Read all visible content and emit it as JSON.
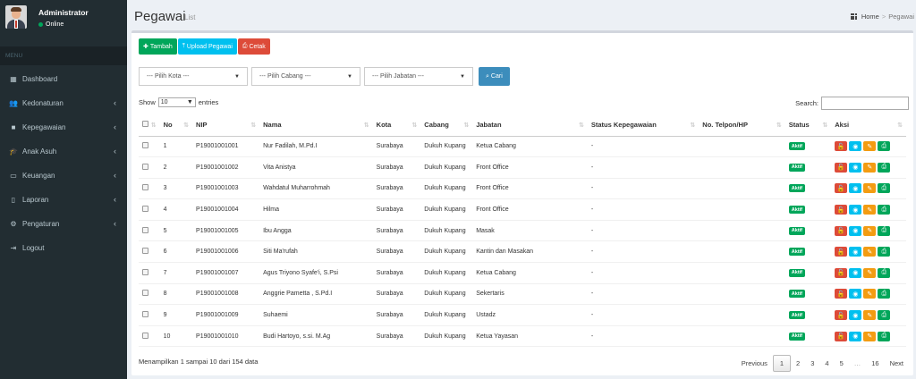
{
  "user": {
    "name": "Administrator",
    "status": "Online"
  },
  "menu_header": "MENU",
  "menu": [
    {
      "label": "Dashboard",
      "icon": "dashboard-icon",
      "glyph": "▦",
      "expandable": false
    },
    {
      "label": "Kedonaturan",
      "icon": "users-icon",
      "glyph": "👥",
      "expandable": true
    },
    {
      "label": "Kepegawaian",
      "icon": "briefcase-icon",
      "glyph": "■",
      "expandable": true
    },
    {
      "label": "Anak Asuh",
      "icon": "graduation-cap-icon",
      "glyph": "🎓",
      "expandable": true
    },
    {
      "label": "Keuangan",
      "icon": "money-icon",
      "glyph": "▭",
      "expandable": true
    },
    {
      "label": "Laporan",
      "icon": "file-icon",
      "glyph": "▯",
      "expandable": true
    },
    {
      "label": "Pengaturan",
      "icon": "gear-icon",
      "glyph": "⚙",
      "expandable": true
    },
    {
      "label": "Logout",
      "icon": "sign-out-icon",
      "glyph": "⇥",
      "expandable": false
    }
  ],
  "page": {
    "title": "Pegawai",
    "subtitle": "List"
  },
  "breadcrumb": {
    "home": "Home",
    "current": "Pegawai"
  },
  "toolbar": {
    "add": "Tambah",
    "upload": "Upload Pegawai",
    "print": "Cetak"
  },
  "filters": {
    "kota": "--- Pilih Kota ---",
    "cabang": "--- Pilih Cabang ---",
    "jabatan": "--- Pilih Jabatan ---",
    "search_button": "Cari"
  },
  "length": {
    "show": "Show",
    "value": "10",
    "entries": "entries"
  },
  "search_label": "Search:",
  "columns": [
    "No",
    "NIP",
    "Nama",
    "Kota",
    "Cabang",
    "Jabatan",
    "Status Kepegawaian",
    "No. Telpon/HP",
    "Status",
    "Aksi"
  ],
  "rows": [
    {
      "no": "1",
      "nip": "P19001001001",
      "nama": "Nur Fadilah, M.Pd.I",
      "kota": "Surabaya",
      "cabang": "Dukuh Kupang",
      "jabatan": "Ketua Cabang",
      "status_kep": "-",
      "telp": "",
      "status": "Aktif"
    },
    {
      "no": "2",
      "nip": "P19001001002",
      "nama": "Vita Anistya",
      "kota": "Surabaya",
      "cabang": "Dukuh Kupang",
      "jabatan": "Front Office",
      "status_kep": "-",
      "telp": "",
      "status": "Aktif"
    },
    {
      "no": "3",
      "nip": "P19001001003",
      "nama": "Wahdatul Muharrohmah",
      "kota": "Surabaya",
      "cabang": "Dukuh Kupang",
      "jabatan": "Front Office",
      "status_kep": "-",
      "telp": "",
      "status": "Aktif"
    },
    {
      "no": "4",
      "nip": "P19001001004",
      "nama": "Hilma",
      "kota": "Surabaya",
      "cabang": "Dukuh Kupang",
      "jabatan": "Front Office",
      "status_kep": "-",
      "telp": "",
      "status": "Aktif"
    },
    {
      "no": "5",
      "nip": "P19001001005",
      "nama": "Ibu Angga",
      "kota": "Surabaya",
      "cabang": "Dukuh Kupang",
      "jabatan": "Masak",
      "status_kep": "-",
      "telp": "",
      "status": "Aktif"
    },
    {
      "no": "6",
      "nip": "P19001001006",
      "nama": "Siti Ma'rufah",
      "kota": "Surabaya",
      "cabang": "Dukuh Kupang",
      "jabatan": "Kantin dan Masakan",
      "status_kep": "-",
      "telp": "",
      "status": "Aktif"
    },
    {
      "no": "7",
      "nip": "P19001001007",
      "nama": "Agus Triyono Syafe'i, S.Psi",
      "kota": "Surabaya",
      "cabang": "Dukuh Kupang",
      "jabatan": "Ketua Cabang",
      "status_kep": "-",
      "telp": "",
      "status": "Aktif"
    },
    {
      "no": "8",
      "nip": "P19001001008",
      "nama": "Anggrie Pametta , S.Pd.I",
      "kota": "Surabaya",
      "cabang": "Dukuh Kupang",
      "jabatan": "Sekertaris",
      "status_kep": "-",
      "telp": "",
      "status": "Aktif"
    },
    {
      "no": "9",
      "nip": "P19001001009",
      "nama": "Suhaemi",
      "kota": "Surabaya",
      "cabang": "Dukuh Kupang",
      "jabatan": "Ustadz",
      "status_kep": "-",
      "telp": "",
      "status": "Aktif"
    },
    {
      "no": "10",
      "nip": "P19001001010",
      "nama": "Budi Hartoyo, s.si. M.Ag",
      "kota": "Surabaya",
      "cabang": "Dukuh Kupang",
      "jabatan": "Ketua Yayasan",
      "status_kep": "-",
      "telp": "",
      "status": "Aktif"
    }
  ],
  "info": "Menampilkan 1 sampai 10 dari 154 data",
  "pagination": {
    "previous": "Previous",
    "pages": [
      "1",
      "2",
      "3",
      "4",
      "5"
    ],
    "ellipsis": "…",
    "last": "16",
    "next": "Next"
  }
}
